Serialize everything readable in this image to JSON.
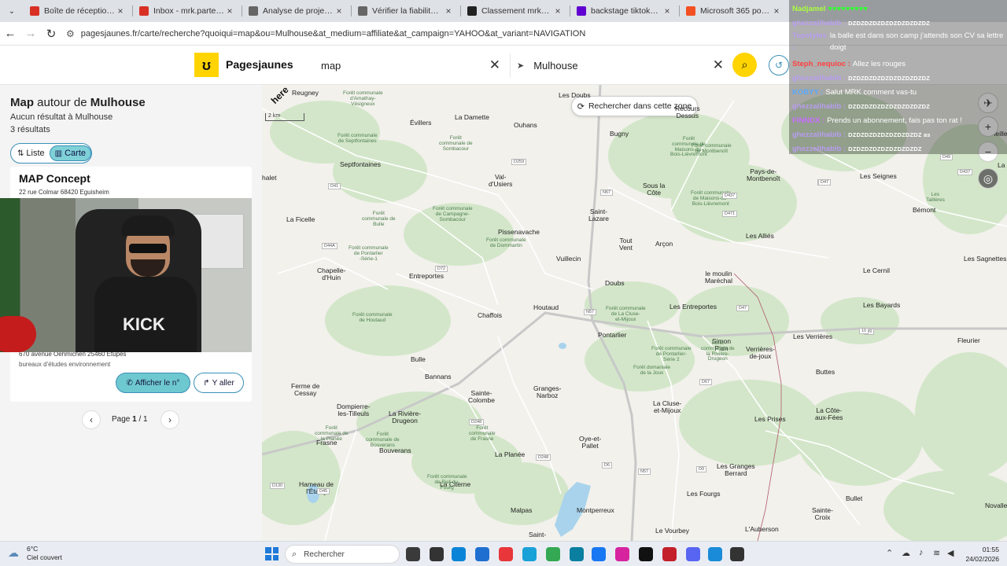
{
  "browser": {
    "tabs": [
      {
        "label": "Boîte de réception (1 792)",
        "favicon_color": "#d93025",
        "favicon_icon": "gmail-icon"
      },
      {
        "label": "Inbox - mrk.partenaires@",
        "favicon_color": "#d93025",
        "favicon_icon": "gmail-icon"
      },
      {
        "label": "Analyse de projet média",
        "favicon_color": "#666666",
        "favicon_icon": "openai-icon"
      },
      {
        "label": "Vérifier la fiabilité d'une a",
        "favicon_color": "#666666",
        "favicon_icon": "openai-icon"
      },
      {
        "label": "Classement mrk_tvi | Le m",
        "favicon_color": "#222222",
        "favicon_icon": "site-icon"
      },
      {
        "label": "backstage tiktok$ - Yahoo",
        "favicon_color": "#6001d2",
        "favicon_icon": "yahoo-icon"
      },
      {
        "label": "Microsoft 365 pour les pa",
        "favicon_color": "#f25022",
        "favicon_icon": "microsoft-icon"
      }
    ],
    "url": "pagesjaunes.fr/carte/recherche?quoiqui=map&ou=Mulhouse&at_medium=affiliate&at_campaign=YAHOO&at_variant=NAVIGATION"
  },
  "header": {
    "logo_glyph": "ʊ",
    "brand": "Pagesjaunes",
    "search_what": "map",
    "search_where": "Mulhouse"
  },
  "results": {
    "title_bold_1": "Map",
    "title_mid": " autour de ",
    "title_bold_2": "Mulhouse",
    "subtitle": "Aucun résultat à Mulhouse",
    "count": "3 résultats",
    "view_list_label": "Liste",
    "view_map_label": "Carte",
    "card": {
      "name": "MAP Concept",
      "address": "22 rue Colmar 68420 Eguisheim",
      "address2": "670 avenue Oehmichen 25460 Etupes",
      "category": "bureaux d'études environnement",
      "phone_button": "Afficher le n°",
      "go_button": "Y aller"
    },
    "pager": {
      "prefix": "Page ",
      "current": "1",
      "sep": " / ",
      "total": "1"
    }
  },
  "webcam": {
    "shirt_text": "KICK"
  },
  "map": {
    "search_area_label": "Rechercher dans cette zone",
    "scale_label": "2 km",
    "provider": "here",
    "labels": [
      {
        "text": "Reugney",
        "cls": "town"
      },
      {
        "text": "Les Doubs",
        "cls": "town"
      },
      {
        "text": "La Damette",
        "cls": "town"
      },
      {
        "text": "Évillers",
        "cls": "town"
      },
      {
        "text": "Ouhans",
        "cls": "town"
      },
      {
        "text": "Bugny",
        "cls": "town"
      },
      {
        "text": "Recours\nDessus",
        "cls": "town"
      },
      {
        "text": "Septfontaines",
        "cls": "town"
      },
      {
        "text": "Val-\nd'Usiers",
        "cls": "town"
      },
      {
        "text": "Sous la\nCôte",
        "cls": "town"
      },
      {
        "text": "Pays-de-\nMontbenoît",
        "cls": "town"
      },
      {
        "text": "Les Seignes",
        "cls": "town"
      },
      {
        "text": "La Ficelle",
        "cls": "town"
      },
      {
        "text": "Saint-\nLazare",
        "cls": "town"
      },
      {
        "text": "Bémont",
        "cls": "town"
      },
      {
        "text": "Pissenavache",
        "cls": "town"
      },
      {
        "text": "Tout\nVent",
        "cls": "town"
      },
      {
        "text": "Arçon",
        "cls": "town"
      },
      {
        "text": "Les Alliés",
        "cls": "town"
      },
      {
        "text": "Vuillecin",
        "cls": "town"
      },
      {
        "text": "Chapelle-\nd'Huin",
        "cls": "town"
      },
      {
        "text": "Entreportes",
        "cls": "town"
      },
      {
        "text": "Doubs",
        "cls": "town"
      },
      {
        "text": "le moulin\nMaréchal",
        "cls": "town"
      },
      {
        "text": "Le Cernil",
        "cls": "town"
      },
      {
        "text": "Les Sagnettes",
        "cls": "town"
      },
      {
        "text": "Chaffois",
        "cls": "town"
      },
      {
        "text": "Houtaud",
        "cls": "town"
      },
      {
        "text": "Les Entreportes",
        "cls": "town"
      },
      {
        "text": "Les Bayards",
        "cls": "town"
      },
      {
        "text": "Pontarlier",
        "cls": "town"
      },
      {
        "text": "Simon\nPion",
        "cls": "town"
      },
      {
        "text": "Verrières-\nde-joux",
        "cls": "town"
      },
      {
        "text": "Les Verrières",
        "cls": "town"
      },
      {
        "text": "Fleurier",
        "cls": "town"
      },
      {
        "text": "Bulle",
        "cls": "town"
      },
      {
        "text": "Bannans",
        "cls": "town"
      },
      {
        "text": "Buttes",
        "cls": "town"
      },
      {
        "text": "Ferme de\nCessay",
        "cls": "town"
      },
      {
        "text": "Sainte-\nColombe",
        "cls": "town"
      },
      {
        "text": "Granges-\nNarboz",
        "cls": "town"
      },
      {
        "text": "La Cluse-\net-Mijoux",
        "cls": "town"
      },
      {
        "text": "Dompierre-\nles-Tilleuls",
        "cls": "town"
      },
      {
        "text": "La Rivière-\nDrugeon",
        "cls": "town"
      },
      {
        "text": "La Côte-\naux-Fées",
        "cls": "town"
      },
      {
        "text": "Les Prises",
        "cls": "town"
      },
      {
        "text": "Frasne",
        "cls": "town"
      },
      {
        "text": "Oye-et-\nPallet",
        "cls": "town"
      },
      {
        "text": "Bouverans",
        "cls": "town"
      },
      {
        "text": "La Planée",
        "cls": "town"
      },
      {
        "text": "Les Granges\nBerrard",
        "cls": "town"
      },
      {
        "text": "Hameau de\nl'Étang",
        "cls": "town"
      },
      {
        "text": "La Citerne",
        "cls": "town"
      },
      {
        "text": "Les Fourgs",
        "cls": "town"
      },
      {
        "text": "Bullet",
        "cls": "town"
      },
      {
        "text": "Malpas",
        "cls": "town"
      },
      {
        "text": "Montperreux",
        "cls": "town"
      },
      {
        "text": "Novalles",
        "cls": "town"
      },
      {
        "text": "Sainte-\nCroix",
        "cls": "town"
      },
      {
        "text": "Le Vourbey",
        "cls": "town"
      },
      {
        "text": "L'Auberson",
        "cls": "town"
      },
      {
        "text": "Saint-",
        "cls": "town"
      },
      {
        "text": "halet",
        "cls": "town"
      },
      {
        "text": "Vieille",
        "cls": "town"
      },
      {
        "text": "La Brév",
        "cls": "town"
      },
      {
        "text": "Les\nTaillères",
        "cls": "green"
      },
      {
        "text": "Forêt communale\nd'Amathay-\nVésigneux",
        "cls": "green"
      },
      {
        "text": "Forêt communale\nde Septfontaines",
        "cls": "green"
      },
      {
        "text": "Forêt\ncommunale de\nSombacour",
        "cls": "green"
      },
      {
        "text": "Forêt communale\nde Montbenoît",
        "cls": "green"
      },
      {
        "text": "Forêt\ncommunale de\nMaisons-du-\nBois-Lièvremont",
        "cls": "green"
      },
      {
        "text": "Forêt communale\nde Maisons-du-\nBois-Lièvremont",
        "cls": "green"
      },
      {
        "text": "Forêt communale\nde Campagne-\nSombacour",
        "cls": "green"
      },
      {
        "text": "Forêt communale\nde Dommartin",
        "cls": "green"
      },
      {
        "text": "Forêt\ncommunale de\nBulle",
        "cls": "green"
      },
      {
        "text": "Forêt communale\nde Houtaud",
        "cls": "green"
      },
      {
        "text": "Forêt communale\nde Pontarlier\n-Série-1",
        "cls": "green"
      },
      {
        "text": "Forêt communale\nde Pontarlier-\nSérie 2",
        "cls": "green"
      },
      {
        "text": "Forêt domaniale\nde la Joux",
        "cls": "green"
      },
      {
        "text": "Forêt communale\nde La Cluse-\net-Mijoux",
        "cls": "green"
      },
      {
        "text": "Forêt\ncommunale de\nla Rivière-\nDrugeon",
        "cls": "green"
      },
      {
        "text": "Forêt\ncommunale de\nBouverans",
        "cls": "green"
      },
      {
        "text": "Forêt\ncommunale\nde Frasne",
        "cls": "green"
      },
      {
        "text": "Forêt\ncommunale de\nla Planée",
        "cls": "green"
      },
      {
        "text": "Forêt communale\nde Bief-du-\nFourg",
        "cls": "green"
      }
    ],
    "road_numbers": [
      "D259",
      "D437",
      "N57",
      "D437",
      "D47",
      "D41",
      "D44A",
      "D72",
      "D471",
      "N57",
      "D47",
      "D9",
      "D248",
      "D67",
      "D248",
      "D130",
      "D45",
      "N57",
      "D6",
      "D9",
      "D49",
      "10",
      "D47"
    ]
  },
  "chat": {
    "lines": [
      {
        "user": "Nadjamel",
        "user_color": "#a9ff3d",
        "msg": "♥♥♥♥♥♥♥♥♥",
        "small": false
      },
      {
        "user": "ghezzalihabib :",
        "user_color": "#b89cf0",
        "msg": "DZDZDZDZDZDZDZDZDZDZ",
        "small": true
      },
      {
        "user": "Topstyles :",
        "user_color": "#b89cf0",
        "msg": "la balle est dans son camp j'attends son CV sa lettre doigt",
        "small": false,
        "wrap": true
      },
      {
        "user": "Steph_nequioc :",
        "user_color": "#ff4040",
        "msg": "Allez les rouges",
        "small": false
      },
      {
        "user": "ghezzalihabib :",
        "user_color": "#b89cf0",
        "msg": "DZDZDZDZDZDZDZDZDZDZ",
        "small": true
      },
      {
        "user": "KOBYY :",
        "user_color": "#5aa8ff",
        "msg": "Salut MRK comment vas-tu",
        "small": false
      },
      {
        "user": "ghezzalihabib :",
        "user_color": "#b89cf0",
        "msg": "DZDZDZDZDZDZDZDZDZDZ",
        "small": true
      },
      {
        "user": "FINNDX :",
        "user_color": "#c86cff",
        "msg": "Prends un abonnement, fais pas ton rat !",
        "small": false
      },
      {
        "user": "ghezzalihabib :",
        "user_color": "#b89cf0",
        "msg": "DZDZDZDZDZDZDZDZDZ as",
        "small": true
      },
      {
        "user": "ghezzalihabib :",
        "user_color": "#b89cf0",
        "msg": "DZDZDZDZDZDZDZDZDZ",
        "small": true
      }
    ]
  },
  "taskbar": {
    "temperature": "6°C",
    "weather": "Ciel couvert",
    "search_label": "Rechercher",
    "time": "01:55",
    "date": "24/02/2026",
    "apps": [
      {
        "icon": "file-explorer-icon",
        "color": "#3a3a3a"
      },
      {
        "icon": "app-icon",
        "color": "#333333"
      },
      {
        "icon": "edge-icon",
        "color": "#0b84d8"
      },
      {
        "icon": "store-icon",
        "color": "#1f6fd1"
      },
      {
        "icon": "app-icon",
        "color": "#e8363b"
      },
      {
        "icon": "app-icon",
        "color": "#1aa1d8"
      },
      {
        "icon": "chrome-icon",
        "color": "#34a853"
      },
      {
        "icon": "edge-icon",
        "color": "#0a7f9f"
      },
      {
        "icon": "facebook-icon",
        "color": "#1877f2"
      },
      {
        "icon": "instagram-icon",
        "color": "#d6249f"
      },
      {
        "icon": "tiktok-icon",
        "color": "#111111"
      },
      {
        "icon": "app-icon",
        "color": "#c4202b"
      },
      {
        "icon": "discord-icon",
        "color": "#5865f2"
      },
      {
        "icon": "app-icon",
        "color": "#1a8bd8"
      },
      {
        "icon": "terminal-icon",
        "color": "#333333"
      }
    ]
  }
}
